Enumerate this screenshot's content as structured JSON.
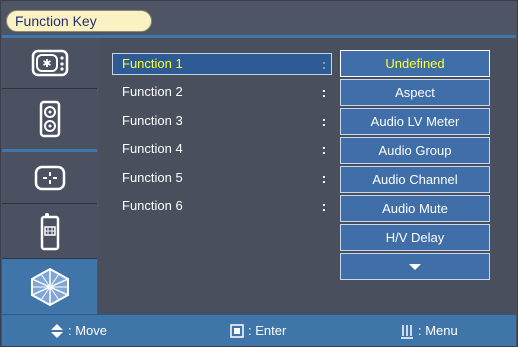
{
  "header": {
    "title": "Function Key"
  },
  "sidebar": {
    "items": [
      {
        "icon": "video-input-icon"
      },
      {
        "icon": "speaker-icon"
      },
      {
        "icon": "crosshair-icon"
      },
      {
        "icon": "remote-control-icon"
      },
      {
        "icon": "function-key-icon",
        "active": true
      }
    ]
  },
  "functions": [
    {
      "label": "Function 1",
      "selected": true
    },
    {
      "label": "Function 2"
    },
    {
      "label": "Function 3"
    },
    {
      "label": "Function 4"
    },
    {
      "label": "Function 5"
    },
    {
      "label": "Function 6"
    }
  ],
  "options": [
    {
      "label": "Undefined",
      "highlighted": true
    },
    {
      "label": "Aspect"
    },
    {
      "label": "Audio LV Meter"
    },
    {
      "label": "Audio Group"
    },
    {
      "label": "Audio Channel"
    },
    {
      "label": "Audio Mute"
    },
    {
      "label": "H/V Delay"
    }
  ],
  "footer": {
    "move_label": ": Move",
    "enter_label": ": Enter",
    "menu_label": ": Menu"
  },
  "colors": {
    "accent": "#3f75a8",
    "selected_text": "#ffff2a",
    "title_pill": "#fbf1c2"
  }
}
